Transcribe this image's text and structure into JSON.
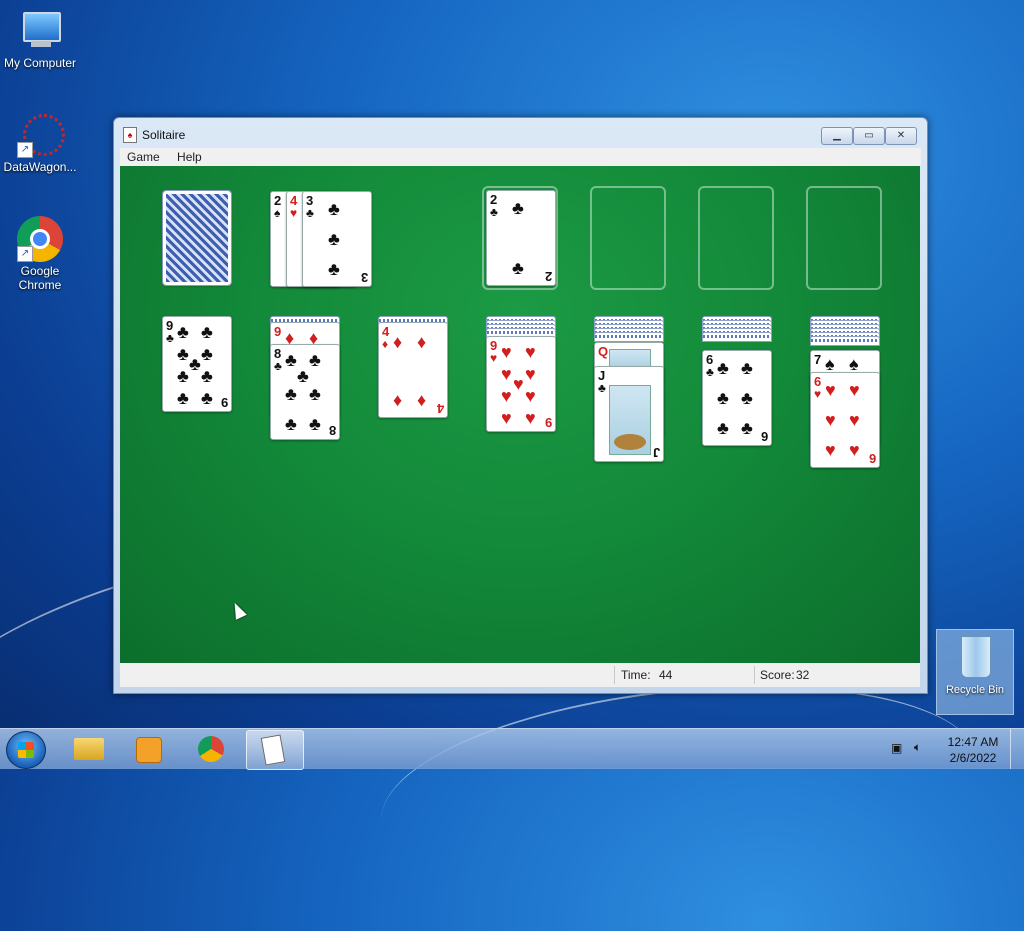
{
  "desktop": {
    "icons": [
      {
        "label": "My Computer"
      },
      {
        "label": "DataWagon..."
      },
      {
        "label": "Google Chrome"
      }
    ],
    "recycle_bin": {
      "label": "Recycle Bin"
    }
  },
  "window": {
    "title": "Solitaire",
    "app_icon_glyph": "♠",
    "controls": {
      "minimize": "▁",
      "maximize": "▭",
      "close": "✕"
    },
    "menu": [
      "Game",
      "Help"
    ]
  },
  "game": {
    "stock": {
      "face_down": true
    },
    "waste": [
      {
        "rank": "2",
        "suit": "♠",
        "color": "blk"
      },
      {
        "rank": "4",
        "suit": "♥",
        "color": "red"
      },
      {
        "rank": "3",
        "suit": "♣",
        "color": "blk"
      }
    ],
    "foundations": [
      {
        "rank": "2",
        "suit": "♣",
        "color": "blk"
      },
      null,
      null,
      null
    ],
    "tableau": [
      {
        "hidden": 0,
        "cards": [
          {
            "rank": "9",
            "suit": "♣",
            "color": "blk"
          }
        ]
      },
      {
        "hidden": 1,
        "cards": [
          {
            "rank": "9",
            "suit": "♦",
            "color": "red"
          },
          {
            "rank": "8",
            "suit": "♣",
            "color": "blk"
          }
        ]
      },
      {
        "hidden": 1,
        "cards": [
          {
            "rank": "4",
            "suit": "♦",
            "color": "red"
          }
        ]
      },
      {
        "hidden": 4,
        "cards": [
          {
            "rank": "9",
            "suit": "♥",
            "color": "red"
          }
        ]
      },
      {
        "hidden": 5,
        "cards": [
          {
            "rank": "Q",
            "suit": "♣",
            "color": "red",
            "face": true
          },
          {
            "rank": "J",
            "suit": "♣",
            "color": "blk",
            "face": true
          }
        ]
      },
      {
        "hidden": 5,
        "cards": [
          {
            "rank": "6",
            "suit": "♣",
            "color": "blk"
          }
        ]
      },
      {
        "hidden": 6,
        "cards": [
          {
            "rank": "7",
            "suit": "♠",
            "color": "blk"
          },
          {
            "rank": "6",
            "suit": "♥",
            "color": "red"
          }
        ]
      }
    ]
  },
  "status": {
    "time_label": "Time:",
    "time_value": "44",
    "score_label": "Score:",
    "score_value": "32"
  },
  "taskbar": {
    "clock_time": "12:47 AM",
    "clock_date": "2/6/2022"
  },
  "colors": {
    "felt": "#138a3a",
    "red_suit": "#d21e1e",
    "black_suit": "#111111"
  }
}
